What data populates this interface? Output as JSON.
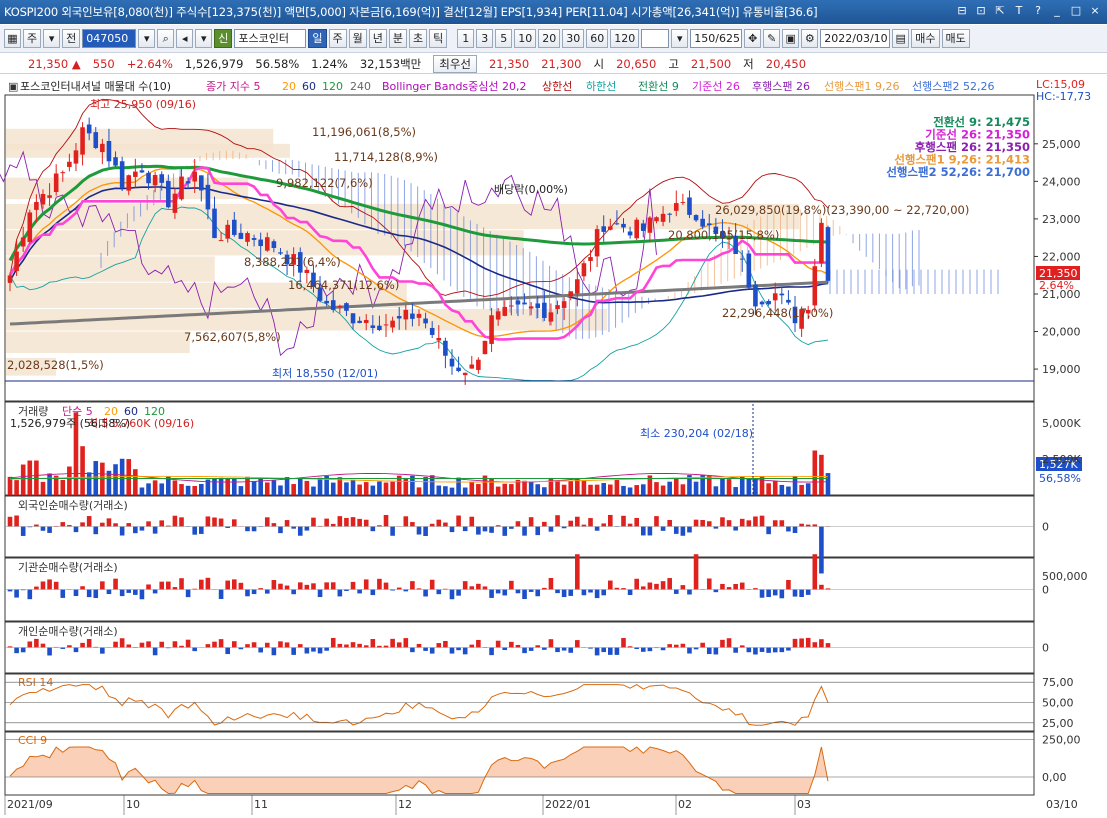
{
  "titlebar": {
    "text": "KOSPI200 외국인보유[8,080(천)] 주식수[123,375(천)] 액면[5,000] 자본금[6,169(억)] 결산[12월] EPS[1,934] PER[11.04] 시가총액[26,341(억)] 유통비율[36.6]",
    "buttons": [
      "⊟",
      "⊡",
      "⇱",
      "T",
      "?",
      "_",
      "□",
      "×"
    ]
  },
  "toolbar": {
    "code_letter": "주",
    "prev_label": "전",
    "code_value": "047050",
    "new_label": "신",
    "stock_name": "포스코인터",
    "period_buttons": [
      "일",
      "주",
      "월",
      "년",
      "분",
      "초",
      "틱"
    ],
    "selected_period": "일",
    "num_buttons": [
      "1",
      "3",
      "5",
      "10",
      "20",
      "30",
      "60",
      "120"
    ],
    "count": "150/625",
    "date": "2022/03/10",
    "buy_label": "매수",
    "sell_label": "매도"
  },
  "infobar": {
    "price": "21,350",
    "arrow": "▲",
    "change": "550",
    "change_pct": "+2.64%",
    "volume": "1,526,979",
    "vol_pct": "56.58%",
    "turnover": "1.24%",
    "amount": "32,153백만",
    "best_label": "최우선",
    "best_ask": "21,350",
    "best_bid": "21,300",
    "open_label": "시",
    "open": "20,650",
    "high_label": "고",
    "high": "21,500",
    "low_label": "저",
    "low": "20,450"
  },
  "legend": {
    "name": "포스코인터내셔널 매물대 수(10)",
    "ma_label": "종가 지수 5",
    "ma20": "20",
    "ma60": "60",
    "ma120": "120",
    "ma240": "240",
    "bb": "Bollinger Bands중심선 20,2",
    "bb_up": "상한선",
    "bb_low": "하한선",
    "ichi_conv": "전환선 9",
    "ichi_base": "기준선 26",
    "ichi_lag": "후행스팬 26",
    "ichi_lead1": "선행스팬1 9,26",
    "ichi_lead2": "선행스팬2 52,26",
    "lc": "LC:15,09",
    "hc": "HC:-17,73"
  },
  "ichimoku_box": [
    {
      "text": "전환선 9: 21,475",
      "color": "#148a5a"
    },
    {
      "text": "기준선 26: 21,350",
      "color": "#d61fd6"
    },
    {
      "text": "후행스팬 26: 21,350",
      "color": "#8a1fb0"
    },
    {
      "text": "선행스팬1 9,26: 21,413",
      "color": "#e89a3c"
    },
    {
      "text": "선행스팬2 52,26: 21,700",
      "color": "#3b6fd6"
    }
  ],
  "price_panel": {
    "high_note": "최고 25,950 (09/16)",
    "low_note": "최저 18,550 (12/01)",
    "dividend_note": "배당락(0,00%)",
    "range_note": "26,029,850(19,8%)(23,390,00 ~ 22,720,00)",
    "current_price": "21,350",
    "current_pct": "2.64%",
    "y_ticks": [
      "25,000",
      "24,000",
      "23,000",
      "22,000",
      "21,000",
      "20,000",
      "19,000"
    ],
    "volume_profile": [
      {
        "label": "11,196,061(8,5%)"
      },
      {
        "label": "11,714,128(8,9%)"
      },
      {
        "label": "9,982,122(7,6%)"
      },
      {
        "label": "26,029,850(19,8%)"
      },
      {
        "label": "20,800,105(15,8%)"
      },
      {
        "label": "8,388,221(6,4%)"
      },
      {
        "label": "16,464,371(12,6%)"
      },
      {
        "label": "22,296,448(17,0%)"
      },
      {
        "label": "7,562,607(5,8%)"
      },
      {
        "label": "2,028,528(1,5%)"
      }
    ]
  },
  "volume_panel": {
    "title": "거래량",
    "ma_label": "단순 5",
    "ma20": "20",
    "ma60": "60",
    "ma120": "120",
    "max_note": "최대 5,760K (09/16)",
    "current": "1,526,979주 (56,58%)",
    "min_note": "최소 230,204 (02/18)",
    "y_ticks": [
      "5,000K",
      "2,500K"
    ],
    "current_badge": "1,527K",
    "pct_badge": "56,58%"
  },
  "foreign_panel": {
    "title": "외국인순매수량(거래소)",
    "y_ticks": [
      "0"
    ]
  },
  "inst_panel": {
    "title": "기관순매수량(거래소)",
    "y_ticks": [
      "500,000",
      "0"
    ]
  },
  "indiv_panel": {
    "title": "개인순매수량(거래소)",
    "y_ticks": [
      "0"
    ]
  },
  "rsi_panel": {
    "title": "RSI 14",
    "y_ticks": [
      "75,00",
      "50,00",
      "25,00"
    ]
  },
  "cci_panel": {
    "title": "CCI 9",
    "y_ticks": [
      "250,00",
      "0,00"
    ]
  },
  "x_axis": {
    "labels": [
      "2021/09",
      "10",
      "11",
      "12",
      "2022/01",
      "02",
      "03"
    ],
    "end_label": "03/10"
  },
  "colors": {
    "up": "#e0221e",
    "down": "#1d4fc8",
    "ma5": "#ff44d8",
    "ma20": "#ff9900",
    "ma60": "#1a2a88",
    "ma120": "#1e9a3a",
    "ma240": "#7a7a7a",
    "bb": "#b01010",
    "cloud_up": "#5f7fd8",
    "cloud_span1": "#f0a870"
  }
}
